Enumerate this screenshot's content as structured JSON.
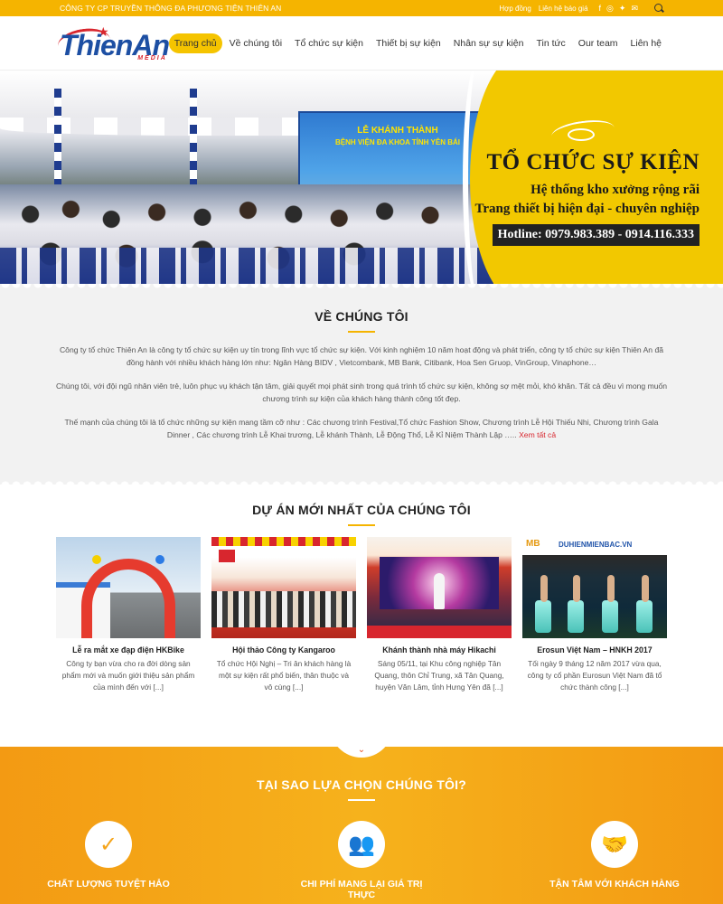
{
  "topbar": {
    "company": "CÔNG TY CP TRUYỀN THÔNG ĐA PHƯƠNG TIỆN THIÊN AN",
    "links": [
      "Hợp đồng",
      "Liên hệ báo giá"
    ],
    "social_icons": [
      "facebook-icon",
      "instagram-icon",
      "twitter-icon",
      "mail-icon"
    ],
    "colors": {
      "bar": "#f5b400"
    }
  },
  "header": {
    "logo_text": "ThienAn",
    "logo_sub": "MEDIA",
    "nav": [
      "Trang chủ",
      "Về chúng tôi",
      "Tổ chức sự kiện",
      "Thiết bị sự kiện",
      "Nhân sự sự kiện",
      "Tin tức",
      "Our team",
      "Liên hệ"
    ],
    "active_index": 0
  },
  "banner": {
    "stage_line1": "LỄ KHÁNH THÀNH",
    "stage_line2": "BỆNH VIỆN ĐA KHOA TỈNH YÊN BÁI",
    "title": "TỔ CHỨC SỰ KIỆN",
    "line1": "Hệ thống kho xưởng rộng rãi",
    "line2": "Trang thiết bị hiện đại - chuyên nghiệp",
    "hotline": "Hotline: 0979.983.389 - 0914.116.333"
  },
  "about": {
    "title": "VỀ CHÚNG TÔI",
    "p1": "Công ty tổ chức Thiên An là công ty tổ chức sự kiện uy tín trong lĩnh vực tổ chức sự kiện. Với kinh nghiệm 10 năm hoạt động và phát triển, công ty tổ chức sự kiện Thiên An đã đồng hành với nhiều khách hàng lớn như:  Ngân Hàng BIDV , Vietcombank, MB Bank, Citibank, Hoa Sen Gruop, VinGroup,  Vinaphone…",
    "p2": "Chúng tôi, với đội ngũ nhân viên trẻ, luôn phục vụ khách tận tâm, giải quyết mọi phát sinh trong quá trình tổ chức sự kiện, không sợ mệt mỏi, khó khăn. Tất cả đều vì mong muốn chương trình sự kiện của khách hàng thành công tốt đẹp.",
    "p3": "Thế mạnh của chúng tôi là tổ chức những sự kiện mang tầm cỡ  như : Các chương trình Festival,Tổ chức Fashion Show, Chương trình Lễ Hội Thiếu Nhi, Chương trình Gala Dinner , Các chương trình Lễ Khai trương, Lễ khánh Thành, Lễ Động Thổ, Lễ Kỉ Niệm Thành Lập …..",
    "more": "Xem tất cả"
  },
  "projects": {
    "title": "DỰ ÁN MỚI NHẤT CỦA CHÚNG TÔI",
    "items": [
      {
        "title": "Lễ ra mắt xe đạp điện HKBike",
        "desc": "Công ty bạn vừa cho ra đời dòng sản phẩm mới và muốn giới thiệu sản phẩm của mình đến với [...]"
      },
      {
        "title": "Hội thảo Công ty Kangaroo",
        "desc": "Tổ chức Hội Nghị – Tri ân khách hàng là một sự kiện rất phổ biến, thân thuộc và vô cùng [...]"
      },
      {
        "title": "Khánh thành nhà máy Hikachi",
        "desc": "Sáng 05/11, tại Khu công nghiệp Tân Quang, thôn Chỉ Trung, xã Tân Quang, huyện Văn Lâm, tỉnh Hưng Yên đã [...]"
      },
      {
        "title": "Erosun Việt Nam – HNKH 2017",
        "desc": "Tối ngày 9 tháng 12 năm 2017 vừa qua, công ty cổ phần Eurosun Việt Nam đã tổ chức thành công [...]"
      }
    ],
    "img4_header": "DUHIENMIENBAC.VN"
  },
  "why": {
    "title": "TẠI SAO LỰA CHỌN CHÚNG TÔI?",
    "items": [
      {
        "title": "CHẤT LƯỢNG TUYỆT HẢO",
        "icon": "check-icon"
      },
      {
        "title": "CHI PHÍ MANG LẠI GIÁ TRỊ THỰC",
        "icon": "team-icon"
      },
      {
        "title": "TẬN TÂM VỚI KHÁCH HÀNG",
        "icon": "handshake-icon"
      }
    ]
  }
}
